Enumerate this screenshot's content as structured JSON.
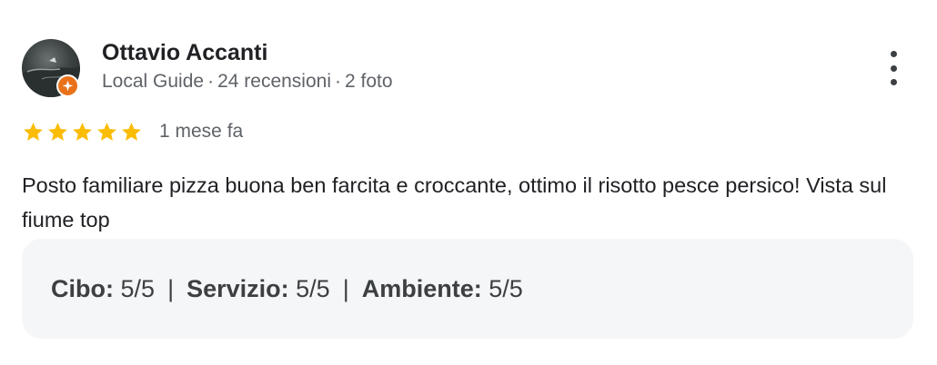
{
  "reviewer": {
    "name": "Ottavio Accanti",
    "badge": "Local Guide",
    "separator": "·",
    "reviews": "24 recensioni",
    "photos": "2 foto",
    "avatar_icon": "profile-photo",
    "badge_icon": "local-guide-star-icon",
    "badge_color": "#e8711a"
  },
  "review": {
    "rating": 5,
    "max_rating": 5,
    "star_color": "#fbbc04",
    "date": "1 mese fa",
    "text": "Posto familiare pizza buona ben farcita e croccante, ottimo il risotto pesce persico! Vista sul fiume top"
  },
  "aspects": {
    "separator": "|",
    "items": [
      {
        "label": "Cibo",
        "colon": ":",
        "value": "5/5"
      },
      {
        "label": "Servizio",
        "colon": ":",
        "value": "5/5"
      },
      {
        "label": "Ambiente",
        "colon": ":",
        "value": "5/5"
      }
    ]
  },
  "actions": {
    "more_icon": "more-vertical-icon"
  }
}
